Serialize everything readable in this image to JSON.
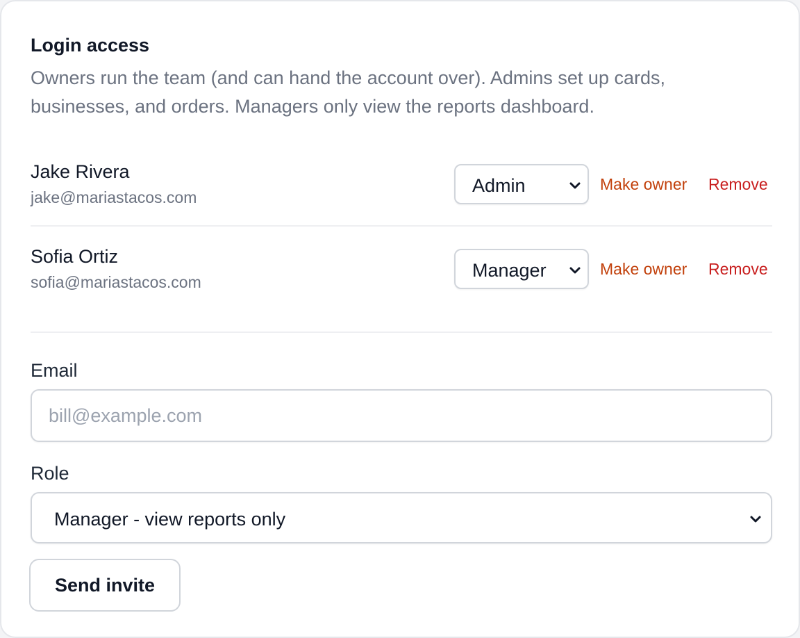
{
  "section": {
    "title": "Login access",
    "description": "Owners run the team (and can hand the account over). Admins set up cards, businesses, and orders. Managers only view the reports dashboard."
  },
  "members": [
    {
      "name": "Jake Rivera",
      "email": "jake@mariastacos.com",
      "role": "Admin",
      "make_owner_label": "Make owner",
      "remove_label": "Remove"
    },
    {
      "name": "Sofia Ortiz",
      "email": "sofia@mariastacos.com",
      "role": "Manager",
      "make_owner_label": "Make owner",
      "remove_label": "Remove"
    }
  ],
  "invite": {
    "email_label": "Email",
    "email_placeholder": "bill@example.com",
    "email_value": "",
    "role_label": "Role",
    "role_value": "Manager - view reports only",
    "send_label": "Send invite"
  },
  "icons": {
    "select_arrow": "chevron-down-icon"
  },
  "colors": {
    "make_owner": "#c2410c",
    "remove": "#c81e1e",
    "muted_text": "#6b7280",
    "border": "#d1d5db"
  }
}
